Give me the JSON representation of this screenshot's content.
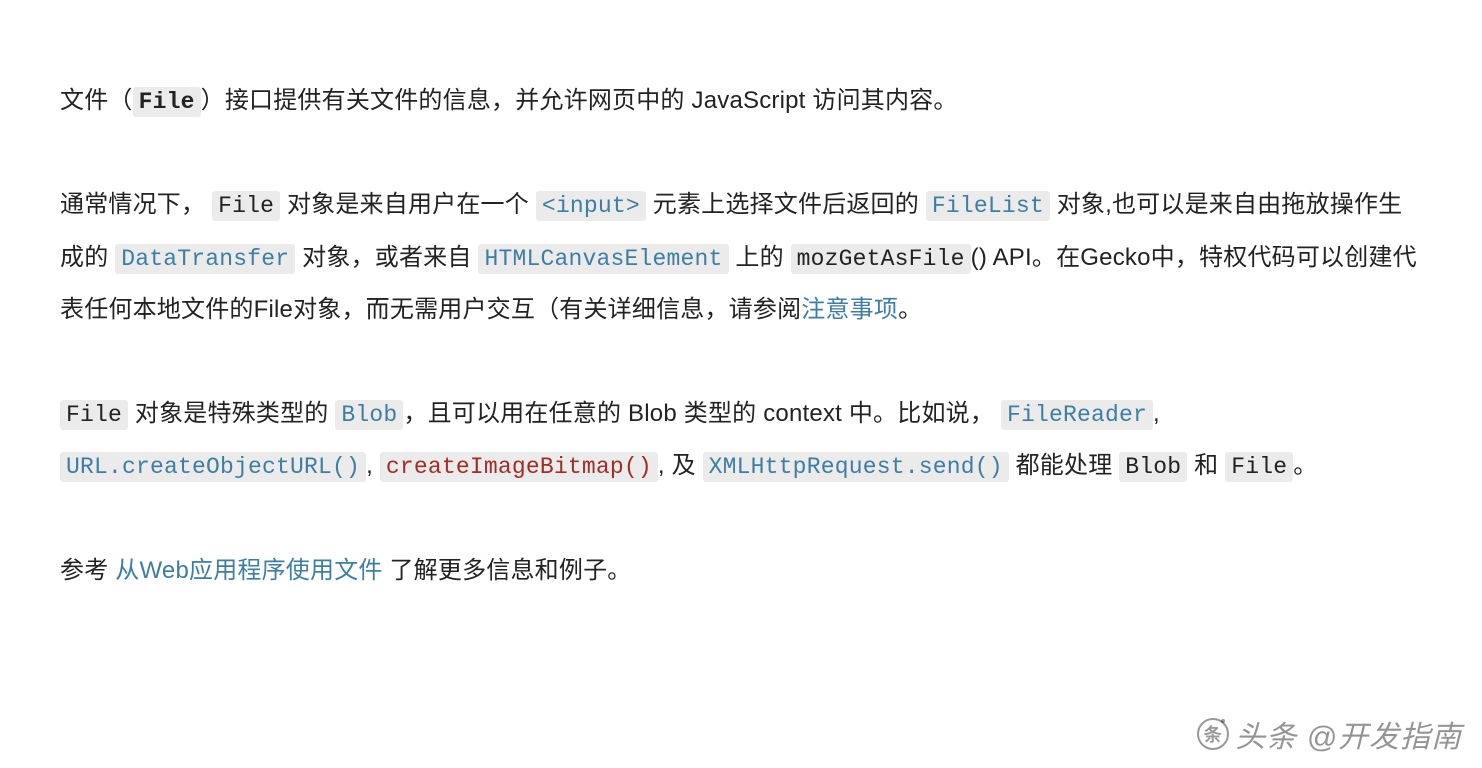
{
  "paragraphs": {
    "p1": {
      "t1": "文件（",
      "code1": "File",
      "t2": "）接口提供有关文件的信息，并允许网页中的 JavaScript 访问其内容。"
    },
    "p2": {
      "t1": "通常情况下， ",
      "code1": "File",
      "t2": " 对象是来自用户在一个 ",
      "code2": "<input>",
      "t3": " 元素上选择文件后返回的 ",
      "code3": "FileList",
      "t4": " 对象,也可以是来自由拖放操作生成的 ",
      "code4": "DataTransfer",
      "t5": " 对象，或者来自 ",
      "code5": "HTMLCanvasElement",
      "t6": " 上的 ",
      "code6": "mozGetAsFile",
      "t7": "() API。在Gecko中，特权代码可以创建代表任何本地文件的File对象，而无需用户交互（有关详细信息，请参阅",
      "link1": "注意事项",
      "t8": "。"
    },
    "p3": {
      "code1": "File",
      "t1": " 对象是特殊类型的 ",
      "code2": "Blob",
      "t2": "，且可以用在任意的 Blob 类型的 context 中。比如说， ",
      "code3": "FileReader",
      "t3": ", ",
      "code4": "URL.createObjectURL()",
      "t4": ", ",
      "code5": "createImageBitmap()",
      "t5": ", 及 ",
      "code6": "XMLHttpRequest.send()",
      "t6": " 都能处理 ",
      "code7": "Blob",
      "t7": " 和  ",
      "code8": "File",
      "t8": "。"
    },
    "p4": {
      "t1": "参考 ",
      "link1": "从Web应用程序使用文件",
      "t2": " 了解更多信息和例子。"
    }
  },
  "watermark": {
    "text": "头条 @开发指南"
  }
}
